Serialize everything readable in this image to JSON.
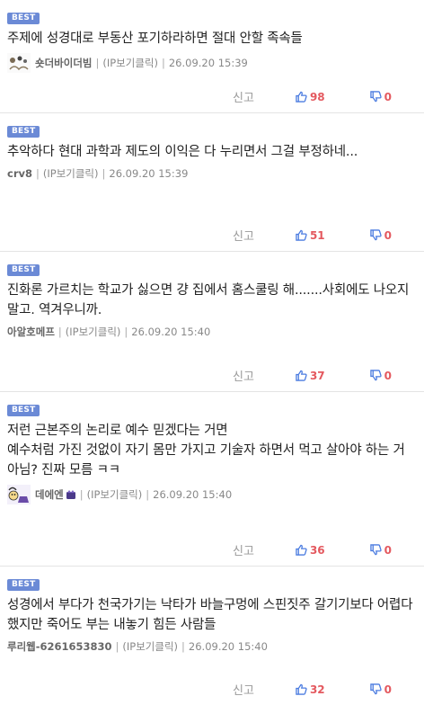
{
  "comments": [
    {
      "badge": "BEST",
      "text": "주제에 성경대로 부동산 포기하라하면 절대 안할 족속들",
      "nickname": "숏더바이더빔",
      "ip_label": "(IP보기클릭)",
      "timestamp": "26.09.20 15:39",
      "report_label": "신고",
      "upvotes": "98",
      "downvotes": "0",
      "has_avatar": true
    },
    {
      "badge": "BEST",
      "text": "추악하다 현대 과학과 제도의 이익은 다 누리면서 그걸 부정하네...",
      "nickname": "crv8",
      "ip_label": "(IP보기클릭)",
      "timestamp": "26.09.20 15:39",
      "report_label": "신고",
      "upvotes": "51",
      "downvotes": "0",
      "has_avatar": false
    },
    {
      "badge": "BEST",
      "text": "진화론 가르치는 학교가 싫으면 걍 집에서 홈스쿨링 해.......사회에도 나오지 말고. 역겨우니까.",
      "nickname": "아알호메프",
      "ip_label": "(IP보기클릭)",
      "timestamp": "26.09.20 15:40",
      "report_label": "신고",
      "upvotes": "37",
      "downvotes": "0",
      "has_avatar": false
    },
    {
      "badge": "BEST",
      "text": "저런 근본주의 논리로 예수 믿겠다는 거면\n예수처럼 가진 것없이 자기 몸만 가지고 기술자 하면서 먹고 살아야 하는 거 아님? 진짜 모름 ㅋㅋ",
      "nickname": "데에엔",
      "ip_label": "(IP보기클릭)",
      "timestamp": "26.09.20 15:40",
      "report_label": "신고",
      "upvotes": "36",
      "downvotes": "0",
      "has_avatar": true
    },
    {
      "badge": "BEST",
      "text": "성경에서 부다가 천국가기는 낙타가 바늘구멍에 스핀짓주 갈기기보다 어렵다 했지만 죽어도 부는 내놓기 힘든 사람들",
      "nickname": "루리웹-6261653830",
      "ip_label": "(IP보기클릭)",
      "timestamp": "26.09.20 15:40",
      "report_label": "신고",
      "upvotes": "32",
      "downvotes": "0",
      "has_avatar": false
    }
  ],
  "colors": {
    "badge": "#6b8ad6",
    "vote_count": "#e4595f",
    "thumb_icon": "#4a7be0"
  },
  "icons": {
    "upvote": "thumbs-up-icon",
    "downvote": "thumbs-down-icon",
    "avatar": "avatar-icon"
  }
}
